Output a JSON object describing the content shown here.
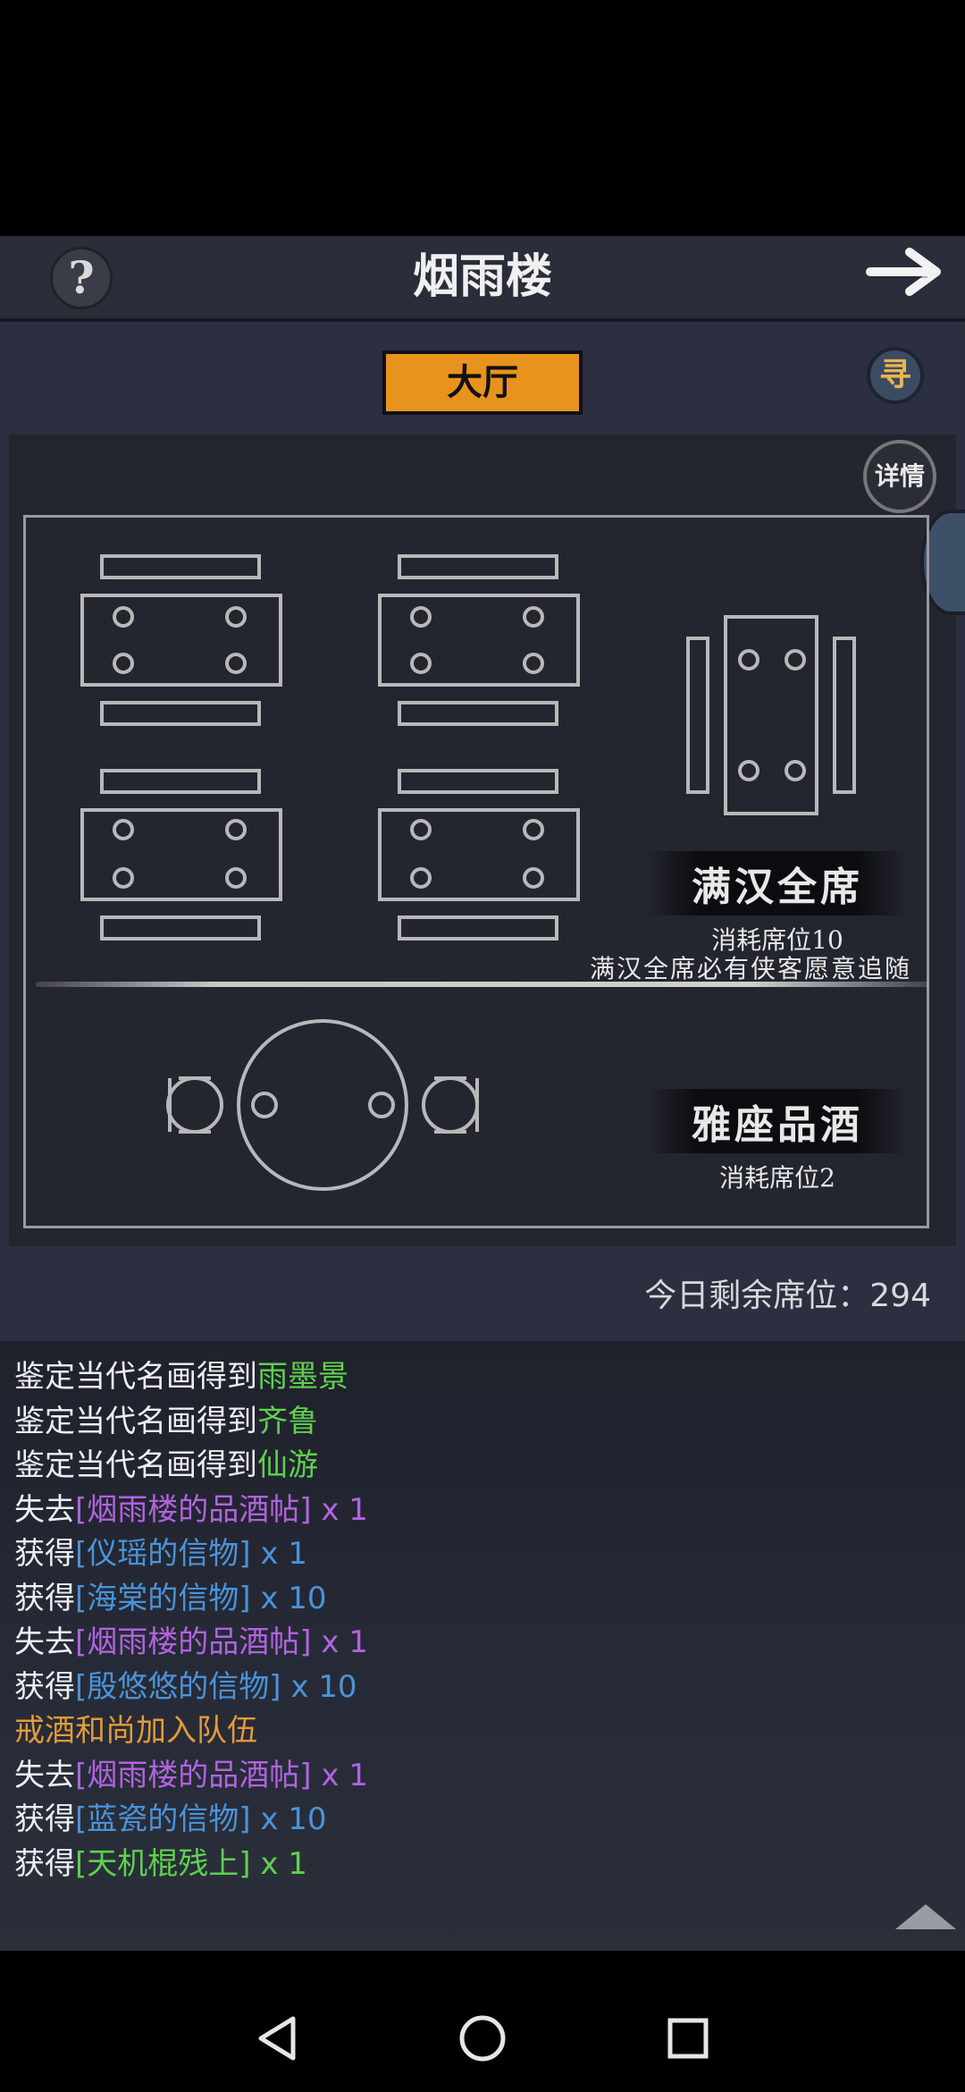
{
  "header": {
    "title": "烟雨楼",
    "help_icon": "?",
    "back_icon": "arrow-right-icon"
  },
  "tabs": {
    "hall_label": "大厅",
    "search_label": "寻"
  },
  "hall": {
    "detail_label": "详情",
    "manhan": {
      "name": "满汉全席",
      "cost": "消耗席位10",
      "note": "满汉全席必有侠客愿意追随"
    },
    "yazuo": {
      "name": "雅座品酒",
      "cost": "消耗席位2"
    },
    "seats_remaining": "今日剩余席位：294"
  },
  "log": [
    {
      "prefix": "鉴定当代名画得到",
      "item": "雨墨景",
      "suffix": "",
      "color": "green"
    },
    {
      "prefix": "鉴定当代名画得到",
      "item": "齐鲁",
      "suffix": "",
      "color": "green"
    },
    {
      "prefix": "鉴定当代名画得到",
      "item": "仙游",
      "suffix": "",
      "color": "green"
    },
    {
      "prefix": "失去",
      "item": "[烟雨楼的品酒帖]",
      "suffix": " x 1",
      "color": "purple"
    },
    {
      "prefix": "获得",
      "item": "[仪瑶的信物]",
      "suffix": " x 1",
      "color": "blue"
    },
    {
      "prefix": "获得",
      "item": "[海棠的信物]",
      "suffix": " x 10",
      "color": "blue"
    },
    {
      "prefix": "失去",
      "item": "[烟雨楼的品酒帖]",
      "suffix": " x 1",
      "color": "purple"
    },
    {
      "prefix": "获得",
      "item": "[殷悠悠的信物]",
      "suffix": " x 10",
      "color": "blue"
    },
    {
      "prefix": "",
      "item": "戒酒和尚加入队伍",
      "suffix": "",
      "color": "orange"
    },
    {
      "prefix": "失去",
      "item": "[烟雨楼的品酒帖]",
      "suffix": " x 1",
      "color": "purple"
    },
    {
      "prefix": "获得",
      "item": "[蓝瓷的信物]",
      "suffix": " x 10",
      "color": "blue"
    },
    {
      "prefix": "获得",
      "item": "[天机棍残上]",
      "suffix": " x 1",
      "color": "green"
    }
  ],
  "colors": {
    "accent_tab": "#e8931e",
    "green": "#5ed14e",
    "purple": "#b163e0",
    "blue": "#4b93d8",
    "orange": "#e39a3a"
  }
}
